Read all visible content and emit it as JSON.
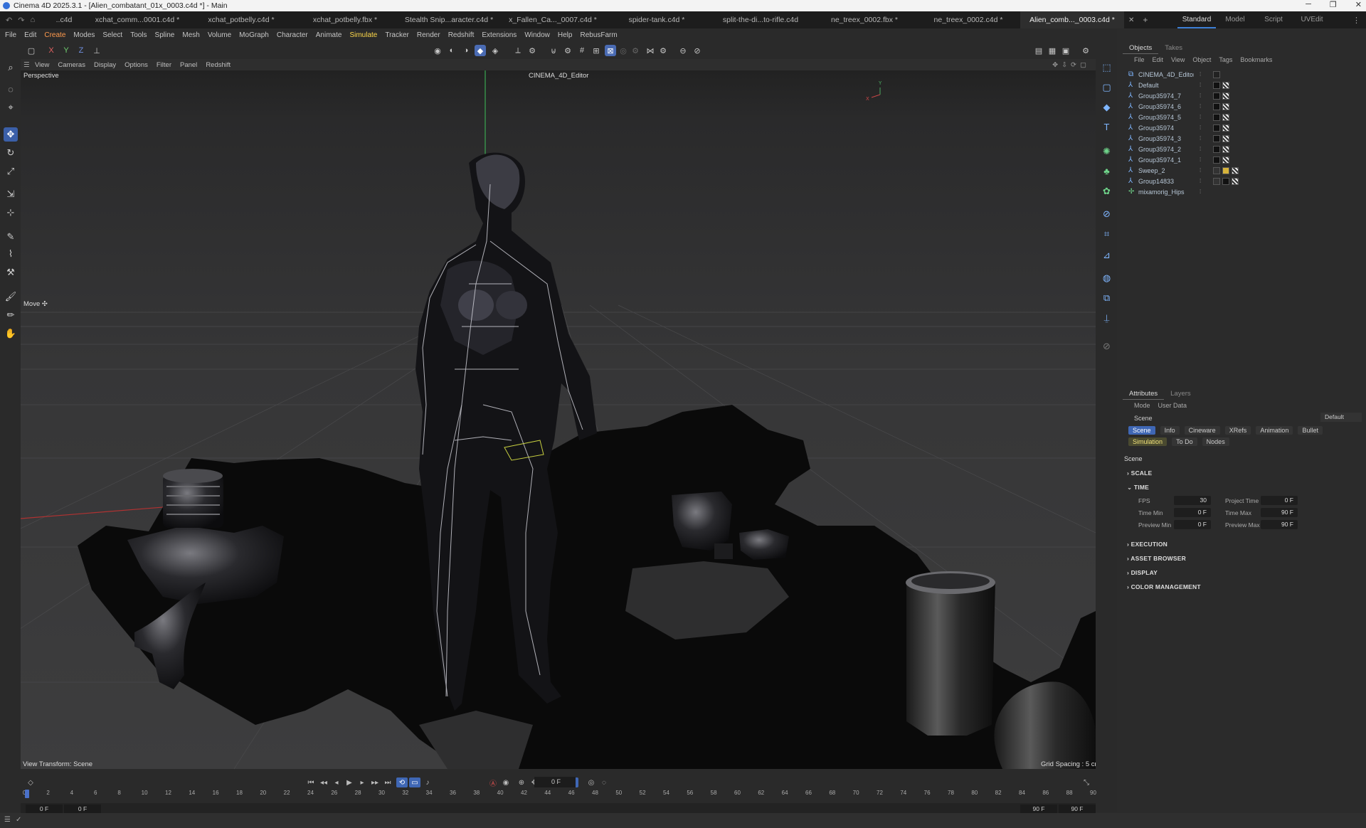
{
  "window": {
    "title": "Cinema 4D 2025.3.1 - [Alien_combatant_01x_0003.c4d *] - Main",
    "buttons": [
      "─",
      "❐",
      "✕"
    ]
  },
  "tabs": [
    "..c4d",
    "xchat_comm...0001.c4d *",
    "xchat_potbelly.c4d *",
    "xchat_potbelly.fbx *",
    "Stealth Snip...aracter.c4d *",
    "x_Fallen_Ca..._0007.c4d *",
    "spider-tank.c4d *",
    "split-the-di...to-rifle.c4d",
    "ne_treex_0002.fbx *",
    "ne_treex_0002.c4d *",
    "Alien_comb..._0003.c4d *"
  ],
  "layouts": [
    "Standard",
    "Model",
    "Script",
    "UVEdit"
  ],
  "menu": [
    "File",
    "Edit",
    "Create",
    "Modes",
    "Select",
    "Tools",
    "Spline",
    "Mesh",
    "Volume",
    "MoGraph",
    "Character",
    "Animate",
    "Simulate",
    "Tracker",
    "Render",
    "Redshift",
    "Extensions",
    "Window",
    "Help",
    "RebusFarm"
  ],
  "toolbar": {
    "axes": [
      "X",
      "Y",
      "Z"
    ]
  },
  "viewport": {
    "menu": [
      "View",
      "Cameras",
      "Display",
      "Options",
      "Filter",
      "Panel",
      "Redshift"
    ],
    "label": "Perspective",
    "camera": "CINEMA_4D_Editor",
    "tool": "Move ✣",
    "view_transform": "View Transform: Scene",
    "grid_spacing": "Grid Spacing : 5 cm"
  },
  "objects_panel": {
    "tabs": [
      "Objects",
      "Takes"
    ],
    "menu": [
      "File",
      "Edit",
      "View",
      "Object",
      "Tags",
      "Bookmarks"
    ],
    "items": [
      {
        "name": "CINEMA_4D_Editor",
        "icon": "camera-icon"
      },
      {
        "name": "Default",
        "icon": "figure-icon"
      },
      {
        "name": "Group35974_7",
        "icon": "figure-icon"
      },
      {
        "name": "Group35974_6",
        "icon": "figure-icon"
      },
      {
        "name": "Group35974_5",
        "icon": "figure-icon"
      },
      {
        "name": "Group35974",
        "icon": "figure-icon"
      },
      {
        "name": "Group35974_3",
        "icon": "figure-icon"
      },
      {
        "name": "Group35974_2",
        "icon": "figure-icon"
      },
      {
        "name": "Group35974_1",
        "icon": "figure-icon"
      },
      {
        "name": "Sweep_2",
        "icon": "figure-icon"
      },
      {
        "name": "Group14833",
        "icon": "figure-icon"
      },
      {
        "name": "mixamorig_Hips",
        "icon": "joint-icon"
      }
    ]
  },
  "attributes_panel": {
    "tabs": [
      "Attributes",
      "Layers"
    ],
    "menu": [
      "Mode",
      "User Data"
    ],
    "object": "Scene",
    "preset": "Default",
    "sub_tabs": [
      "Scene",
      "Info",
      "Cineware",
      "XRefs",
      "Animation",
      "Bullet",
      "Simulation",
      "To Do",
      "Nodes"
    ],
    "heading": "Scene",
    "sections": [
      "SCALE",
      "TIME",
      "EXECUTION",
      "ASSET BROWSER",
      "DISPLAY",
      "COLOR MANAGEMENT"
    ],
    "time": {
      "fps_label": "FPS",
      "fps": "30",
      "project_time_label": "Project Time",
      "project_time": "0 F",
      "time_min_label": "Time Min",
      "time_min": "0 F",
      "time_max_label": "Time Max",
      "time_max": "90 F",
      "preview_min_label": "Preview Min",
      "preview_min": "0 F",
      "preview_max_label": "Preview Max",
      "preview_max": "90 F"
    }
  },
  "transport": {
    "frame": "0 F"
  },
  "timeline": {
    "ticks": [
      "0",
      "2",
      "4",
      "6",
      "8",
      "10",
      "12",
      "14",
      "16",
      "18",
      "20",
      "22",
      "24",
      "26",
      "28",
      "30",
      "32",
      "34",
      "36",
      "38",
      "40",
      "42",
      "44",
      "46",
      "48",
      "50",
      "52",
      "54",
      "56",
      "58",
      "60",
      "62",
      "64",
      "66",
      "68",
      "70",
      "72",
      "74",
      "76",
      "78",
      "80",
      "82",
      "84",
      "86",
      "88",
      "90"
    ],
    "range_start": "0 F",
    "range_start2": "0 F",
    "range_end": "90 F",
    "range_end2": "90 F"
  },
  "colors": {
    "accent": "#3d7fd6",
    "create_menu": "#ff9a4d",
    "simulate_menu": "#ffd94a",
    "x_axis": "#c03a3a",
    "y_axis": "#3fb85a",
    "z_axis": "#3a4fc0"
  }
}
